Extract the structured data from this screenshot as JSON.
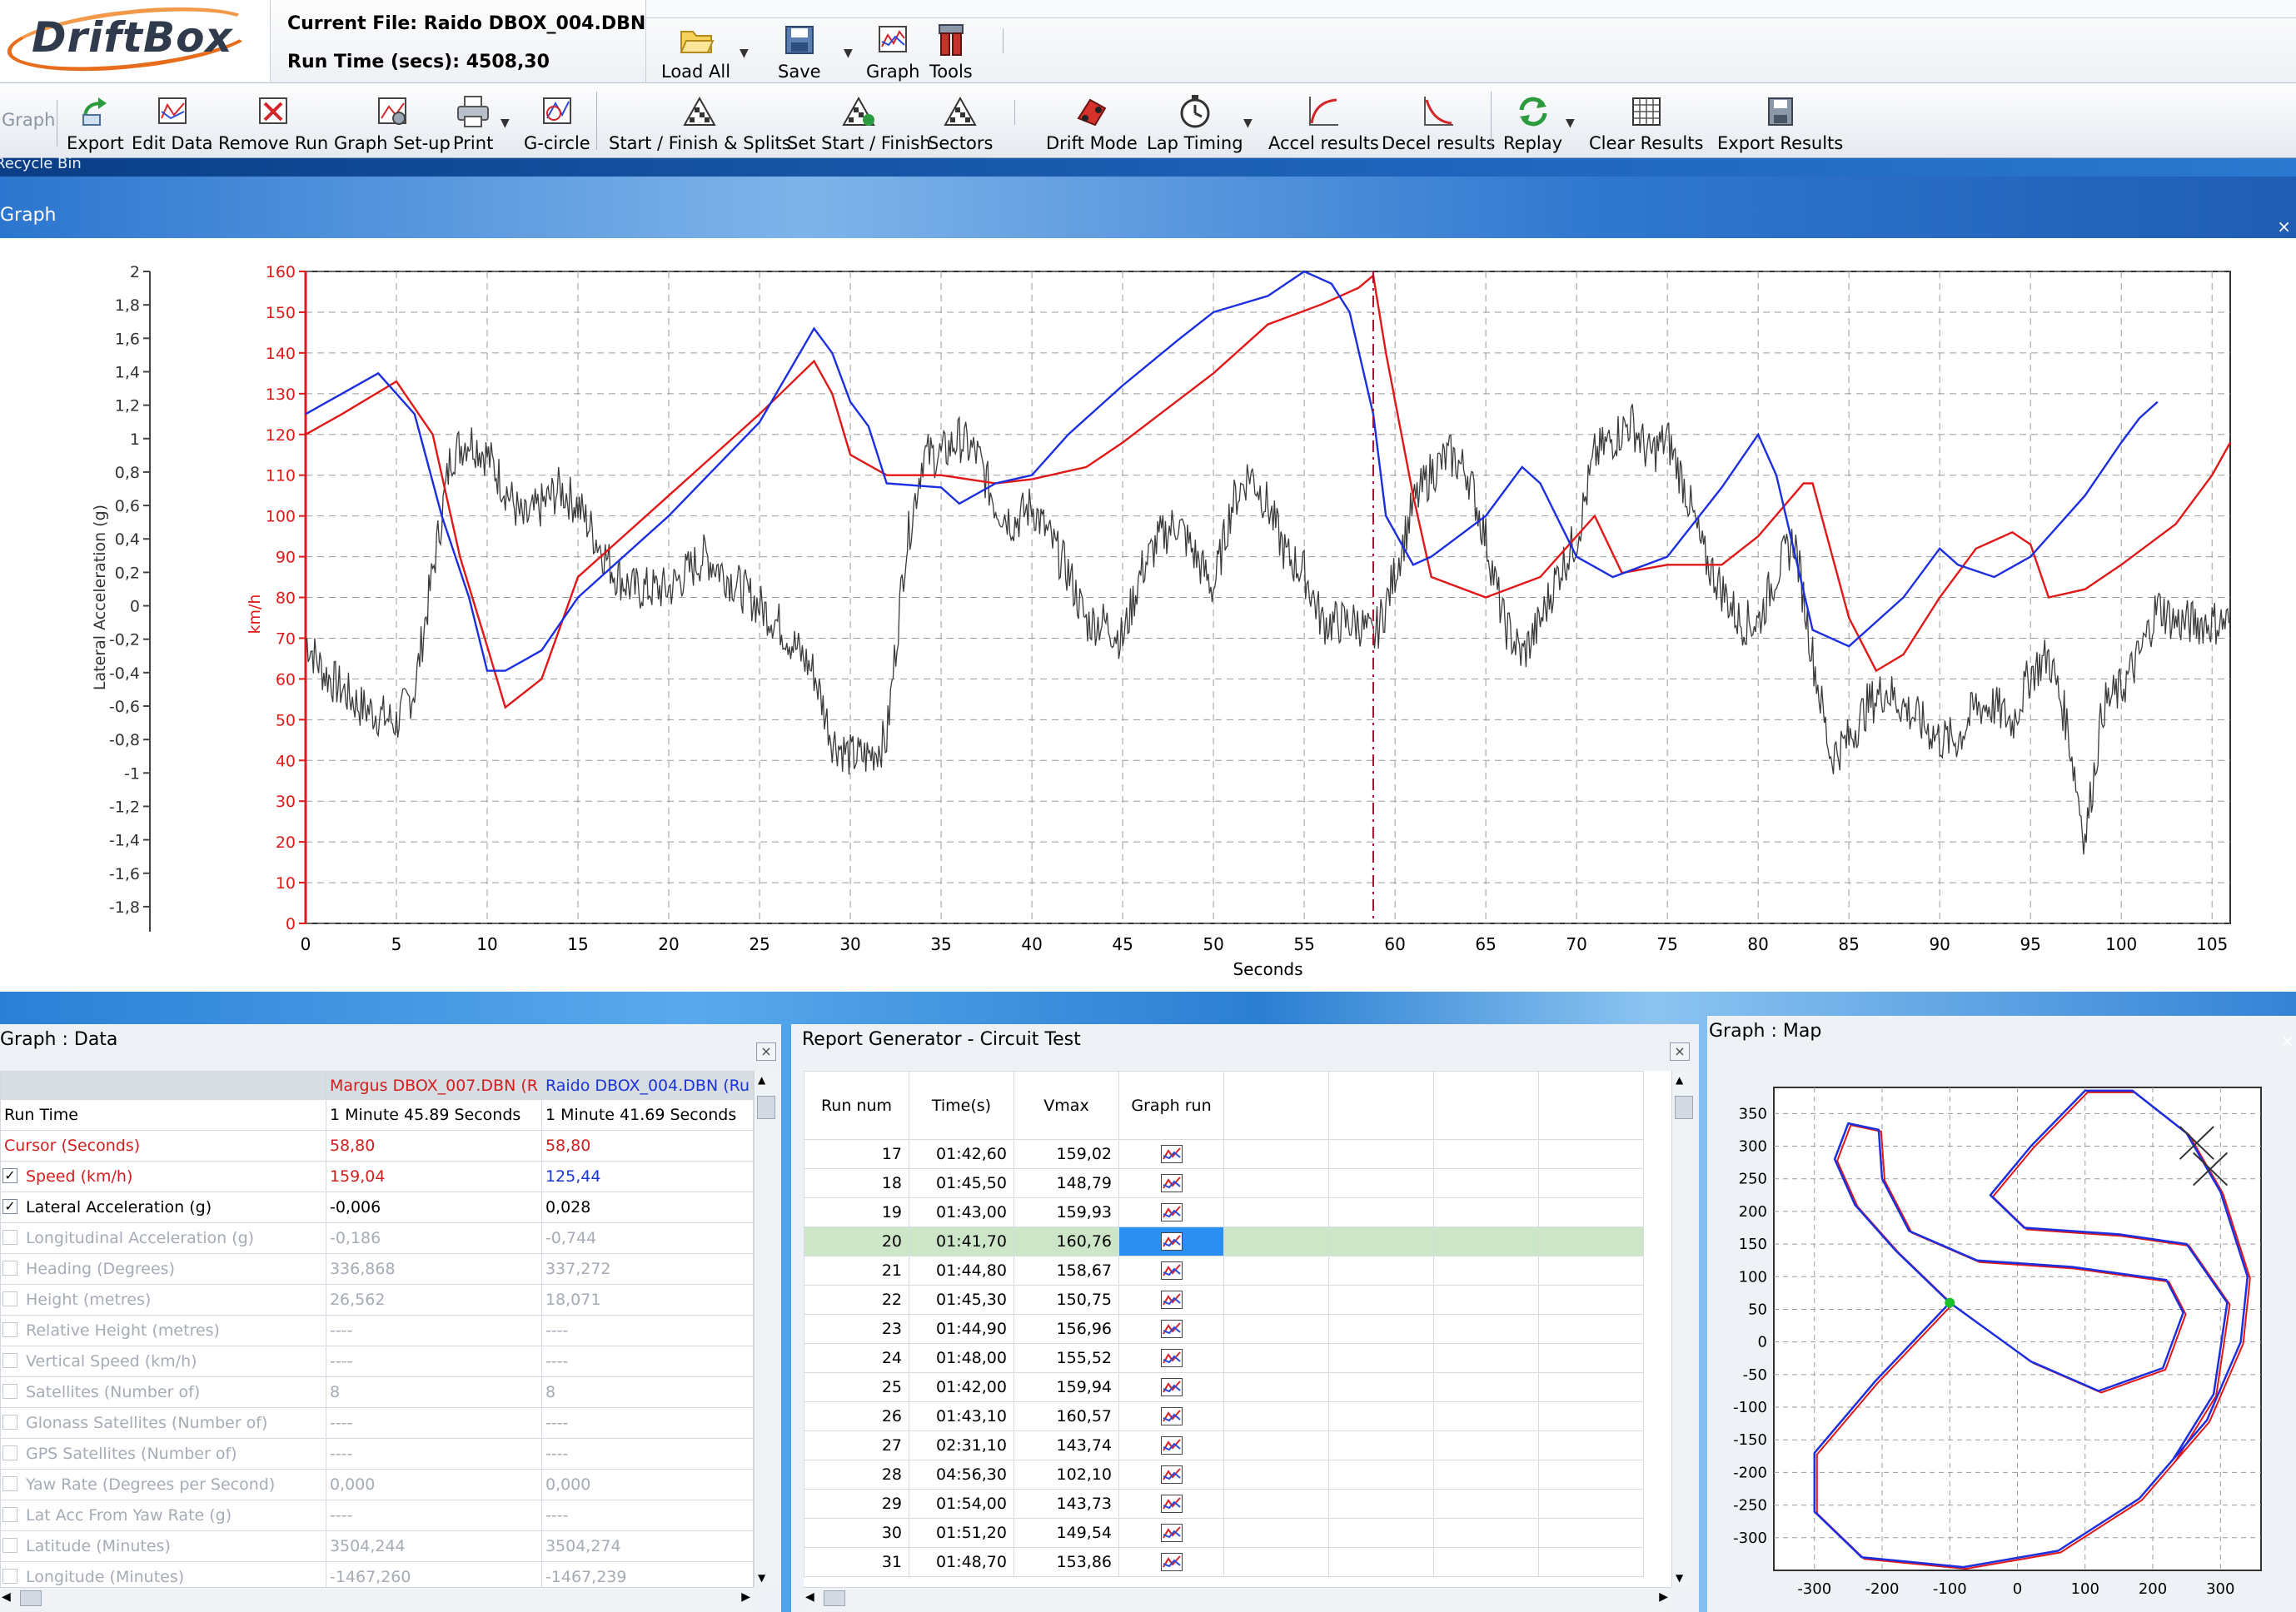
{
  "app": {
    "logo_text": "DriftBox"
  },
  "fileinfo": {
    "current_file_label": "Current File:",
    "current_file": "Raido DBOX_004.DBN",
    "run_time_label": "Run Time (secs):",
    "run_time": "4508,30"
  },
  "quickbar": {
    "load_all": "Load All",
    "save": "Save",
    "graph": "Graph",
    "tools": "Tools"
  },
  "ribbon": {
    "graph_group": "Graph",
    "export": "Export",
    "edit_data": "Edit Data",
    "remove_run": "Remove Run",
    "graph_setup": "Graph Set-up",
    "print": "Print",
    "g_circle": "G-circle",
    "start_finish_splits": "Start / Finish & Splits",
    "set_start_finish": "Set Start / Finish",
    "sectors": "Sectors",
    "drift_mode": "Drift Mode",
    "lap_timing": "Lap Timing",
    "accel_results": "Accel results",
    "decel_results": "Decel results",
    "replay": "Replay",
    "clear_results": "Clear Results",
    "export_results": "Export Results"
  },
  "desktop_strip_text": "Recycle Bin",
  "graph_window": {
    "title": "Graph",
    "close": "×"
  },
  "colors": {
    "speed_red": "#e01818",
    "speed_blue": "#1c2fe0",
    "lat_grey": "#3a3a3a",
    "selected_row": "#cde6c8",
    "accent_blue": "#2a8ff0"
  },
  "chart_data": {
    "type": "line",
    "xlabel": "Seconds",
    "ylabel_left": "Lateral Acceleration (g)",
    "ylabel_right": "km/h",
    "xlim": [
      0,
      106
    ],
    "ylim_speed": [
      0,
      160
    ],
    "ylim_lat": [
      -1.9,
      2.0
    ],
    "x_ticks": [
      "0",
      "5",
      "10",
      "15",
      "20",
      "25",
      "30",
      "35",
      "40",
      "45",
      "50",
      "55",
      "60",
      "65",
      "70",
      "75",
      "80",
      "85",
      "90",
      "95",
      "100",
      "105"
    ],
    "speed_ticks": [
      "0",
      "10",
      "20",
      "30",
      "40",
      "50",
      "60",
      "70",
      "80",
      "90",
      "100",
      "110",
      "120",
      "130",
      "140",
      "150",
      "160"
    ],
    "lat_ticks": [
      "2",
      "1,8",
      "1,6",
      "1,4",
      "1,2",
      "1",
      "0,8",
      "0,6",
      "0,4",
      "0,2",
      "0",
      "-0,2",
      "-0,4",
      "-0,6",
      "-0,8",
      "-1",
      "-1,2",
      "-1,4",
      "-1,6",
      "-1,8"
    ],
    "cursor_x": 58.8,
    "series": [
      {
        "name": "Margus DBOX_007.DBN",
        "color": "#e01818",
        "x": [
          0,
          2,
          5,
          7,
          8.5,
          10,
          11,
          13,
          15,
          20,
          25,
          28,
          29,
          30,
          32,
          35,
          38,
          40,
          43,
          45,
          50,
          53,
          56,
          58,
          58.8,
          59.5,
          61,
          62,
          65,
          68,
          70,
          71,
          72.5,
          75,
          78,
          80,
          82.5,
          83,
          85,
          86.5,
          88,
          90,
          92,
          94,
          95,
          96,
          98,
          100,
          103,
          105,
          106
        ],
        "y": [
          120,
          125,
          133,
          120,
          90,
          68,
          53,
          60,
          85,
          105,
          125,
          138,
          130,
          115,
          110,
          110,
          108,
          109,
          112,
          118,
          135,
          147,
          152,
          156,
          159,
          140,
          105,
          85,
          80,
          85,
          95,
          100,
          86,
          88,
          88,
          95,
          108,
          108,
          75,
          62,
          66,
          80,
          92,
          96,
          93,
          80,
          82,
          88,
          98,
          110,
          118
        ]
      },
      {
        "name": "Raido DBOX_004.DBN",
        "color": "#1c2fe0",
        "x": [
          0,
          2,
          4,
          6,
          7.5,
          9,
          10,
          11,
          13,
          15,
          20,
          25,
          28,
          29,
          30,
          31,
          32,
          35,
          36,
          38,
          40,
          42,
          45,
          48,
          50,
          53,
          55,
          56.5,
          57.5,
          58.8,
          59.5,
          61,
          62,
          65,
          67,
          68,
          70,
          72,
          75,
          78,
          80,
          81,
          83,
          85,
          88,
          90,
          91,
          93,
          95,
          98,
          100,
          101,
          102
        ],
        "y": [
          125,
          130,
          135,
          125,
          100,
          80,
          62,
          62,
          67,
          80,
          100,
          123,
          146,
          140,
          128,
          122,
          108,
          107,
          103,
          108,
          110,
          120,
          132,
          143,
          150,
          154,
          160,
          157,
          150,
          125,
          100,
          88,
          90,
          100,
          112,
          108,
          90,
          85,
          90,
          107,
          120,
          110,
          72,
          68,
          80,
          92,
          88,
          85,
          90,
          105,
          118,
          124,
          128
        ]
      }
    ],
    "lat_series": {
      "name": "Lateral Acceleration (g)",
      "color": "#3a3a3a",
      "x": [
        0,
        1,
        3,
        5,
        6,
        7,
        8,
        9,
        10,
        11,
        12,
        13,
        14,
        15,
        16,
        17,
        18,
        19,
        20,
        22,
        24,
        26,
        28,
        29,
        30,
        31,
        32,
        33,
        34,
        35,
        36,
        37,
        38,
        39,
        40,
        41,
        42,
        43,
        44,
        45,
        46,
        47,
        48,
        49,
        50,
        51,
        52,
        53,
        54,
        55,
        56,
        57,
        58,
        58.8,
        59.5,
        61,
        62,
        63,
        64,
        65,
        66,
        67,
        68,
        69,
        70,
        71,
        72,
        73,
        74,
        75,
        76,
        77,
        78,
        79,
        80,
        81,
        82,
        83,
        84,
        85,
        86,
        87,
        88,
        89,
        90,
        91,
        92,
        93,
        94,
        95,
        96,
        97,
        98,
        99,
        100,
        101,
        102,
        103,
        104,
        105,
        106
      ],
      "y": [
        -0.2,
        -0.4,
        -0.6,
        -0.7,
        -0.5,
        0.2,
        0.9,
        1.0,
        0.9,
        0.7,
        0.5,
        0.6,
        0.7,
        0.6,
        0.4,
        0.2,
        0.1,
        0.1,
        0.1,
        0.3,
        0.1,
        -0.1,
        -0.4,
        -0.8,
        -0.9,
        -0.9,
        -0.8,
        0.3,
        0.9,
        0.9,
        1.0,
        0.9,
        0.6,
        0.5,
        0.6,
        0.4,
        0.2,
        -0.1,
        -0.1,
        -0.2,
        0.2,
        0.4,
        0.5,
        0.3,
        0.1,
        0.6,
        0.8,
        0.6,
        0.3,
        0.2,
        -0.1,
        -0.1,
        -0.1,
        -0.2,
        0.0,
        0.6,
        0.8,
        0.9,
        0.8,
        0.4,
        -0.1,
        -0.3,
        -0.1,
        0.2,
        0.4,
        0.9,
        1.0,
        1.1,
        0.9,
        1.0,
        0.7,
        0.3,
        0.1,
        -0.1,
        -0.1,
        0.2,
        0.4,
        -0.3,
        -0.9,
        -0.8,
        -0.6,
        -0.5,
        -0.6,
        -0.7,
        -0.8,
        -0.8,
        -0.6,
        -0.6,
        -0.7,
        -0.4,
        -0.3,
        -0.7,
        -1.4,
        -0.6,
        -0.5,
        -0.3,
        0.0,
        -0.1,
        -0.1,
        -0.1,
        -0.1
      ]
    }
  },
  "data_panel": {
    "title": "Graph : Data",
    "col1_header": "Margus DBOX_007.DBN (R",
    "col2_header": "Raido DBOX_004.DBN (Ru",
    "rows": [
      {
        "label": "Run Time",
        "v1": "1 Minute 45.89 Seconds",
        "v2": "1 Minute 41.69 Seconds",
        "check": "none",
        "style": "normal"
      },
      {
        "label": "Cursor (Seconds)",
        "v1": "58,80",
        "v2": "58,80",
        "check": "none",
        "style": "cursor"
      },
      {
        "label": "Speed (km/h)",
        "v1": "159,04",
        "v2": "125,44",
        "check": "on",
        "style": "speed"
      },
      {
        "label": "Lateral Acceleration (g)",
        "v1": "-0,006",
        "v2": "0,028",
        "check": "on",
        "style": "normal"
      },
      {
        "label": "Longitudinal Acceleration (g)",
        "v1": "-0,186",
        "v2": "-0,744",
        "check": "off",
        "style": "dis"
      },
      {
        "label": "Heading (Degrees)",
        "v1": "336,868",
        "v2": "337,272",
        "check": "off",
        "style": "dis"
      },
      {
        "label": "Height (metres)",
        "v1": "26,562",
        "v2": "18,071",
        "check": "off",
        "style": "dis"
      },
      {
        "label": "Relative Height (metres)",
        "v1": "----",
        "v2": "----",
        "check": "off",
        "style": "dis"
      },
      {
        "label": "Vertical Speed (km/h)",
        "v1": "----",
        "v2": "----",
        "check": "off",
        "style": "dis"
      },
      {
        "label": "Satellites (Number of)",
        "v1": "8",
        "v2": "8",
        "check": "off",
        "style": "dis"
      },
      {
        "label": "Glonass Satellites (Number of)",
        "v1": "----",
        "v2": "----",
        "check": "off",
        "style": "dis"
      },
      {
        "label": "GPS Satellites (Number of)",
        "v1": "----",
        "v2": "----",
        "check": "off",
        "style": "dis"
      },
      {
        "label": "Yaw Rate (Degrees per Second)",
        "v1": "0,000",
        "v2": "0,000",
        "check": "off",
        "style": "dis"
      },
      {
        "label": "Lat Acc From Yaw Rate (g)",
        "v1": "----",
        "v2": "----",
        "check": "off",
        "style": "dis"
      },
      {
        "label": "Latitude (Minutes)",
        "v1": "3504,244",
        "v2": "3504,274",
        "check": "off",
        "style": "dis"
      },
      {
        "label": "Longitude (Minutes)",
        "v1": "-1467,260",
        "v2": "-1467,239",
        "check": "off",
        "style": "dis"
      }
    ]
  },
  "report_panel": {
    "title": "Report Generator - Circuit Test",
    "headers": [
      "Run num",
      "Time(s)",
      "Vmax",
      "Graph run"
    ],
    "selected_run": "20",
    "rows": [
      {
        "run": "17",
        "time": "01:42,60",
        "vmax": "159,02"
      },
      {
        "run": "18",
        "time": "01:45,50",
        "vmax": "148,79"
      },
      {
        "run": "19",
        "time": "01:43,00",
        "vmax": "159,93"
      },
      {
        "run": "20",
        "time": "01:41,70",
        "vmax": "160,76"
      },
      {
        "run": "21",
        "time": "01:44,80",
        "vmax": "158,67"
      },
      {
        "run": "22",
        "time": "01:45,30",
        "vmax": "150,75"
      },
      {
        "run": "23",
        "time": "01:44,90",
        "vmax": "156,96"
      },
      {
        "run": "24",
        "time": "01:48,00",
        "vmax": "155,52"
      },
      {
        "run": "25",
        "time": "01:42,00",
        "vmax": "159,94"
      },
      {
        "run": "26",
        "time": "01:43,10",
        "vmax": "160,57"
      },
      {
        "run": "27",
        "time": "02:31,10",
        "vmax": "143,74"
      },
      {
        "run": "28",
        "time": "04:56,30",
        "vmax": "102,10"
      },
      {
        "run": "29",
        "time": "01:54,00",
        "vmax": "143,73"
      },
      {
        "run": "30",
        "time": "01:51,20",
        "vmax": "149,54"
      },
      {
        "run": "31",
        "time": "01:48,70",
        "vmax": "153,86"
      }
    ]
  },
  "map_panel": {
    "title": "Graph : Map",
    "x_ticks": [
      "-300",
      "-200",
      "-100",
      "0",
      "100",
      "200",
      "300"
    ],
    "y_ticks": [
      "350",
      "300",
      "250",
      "200",
      "150",
      "100",
      "50",
      "0",
      "-50",
      "-100",
      "-150",
      "-200",
      "-250",
      "-300"
    ]
  }
}
